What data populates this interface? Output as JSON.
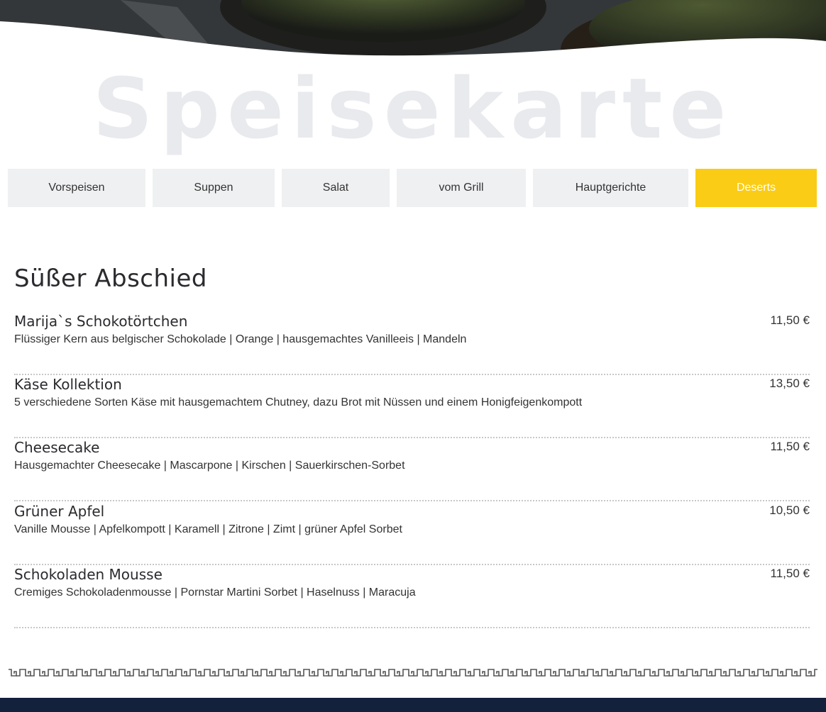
{
  "page": {
    "title": "Speisekarte"
  },
  "tabs": [
    {
      "label": "Vorspeisen",
      "active": false
    },
    {
      "label": "Suppen",
      "active": false
    },
    {
      "label": "Salat",
      "active": false
    },
    {
      "label": "vom Grill",
      "active": false
    },
    {
      "label": "Hauptgerichte",
      "active": false
    },
    {
      "label": "Deserts",
      "active": true
    }
  ],
  "section": {
    "title": "Süßer Abschied",
    "items": [
      {
        "name": "Marija`s Schokotörtchen",
        "description": "Flüssiger Kern aus belgischer Schokolade | Orange | hausgemachtes Vanilleeis | Mandeln",
        "price": "11,50 €"
      },
      {
        "name": "Käse Kollektion",
        "description": "5 verschiedene Sorten Käse mit hausgemachtem Chutney, dazu Brot mit Nüssen und einem Honigfeigenkompott",
        "price": "13,50 €"
      },
      {
        "name": "Cheesecake",
        "description": "Hausgemachter Cheesecake | Mascarpone | Kirschen | Sauerkirschen-Sorbet",
        "price": "11,50 €"
      },
      {
        "name": "Grüner Apfel",
        "description": "Vanille Mousse | Apfelkompott | Karamell | Zitrone | Zimt | grüner Apfel Sorbet",
        "price": "10,50 €"
      },
      {
        "name": "Schokoladen Mousse",
        "description": "Cremiges Schokoladenmousse | Pornstar Martini Sorbet | Haselnuss | Maracuja",
        "price": "11,50 €"
      }
    ]
  },
  "colors": {
    "accent": "#facc15",
    "tab_bg": "#eff0f2",
    "title_watermark": "#e9eaee",
    "footer": "#14213d"
  },
  "icons": {
    "hero": "food-photo-banner",
    "divider": "greek-key-divider-icon"
  }
}
